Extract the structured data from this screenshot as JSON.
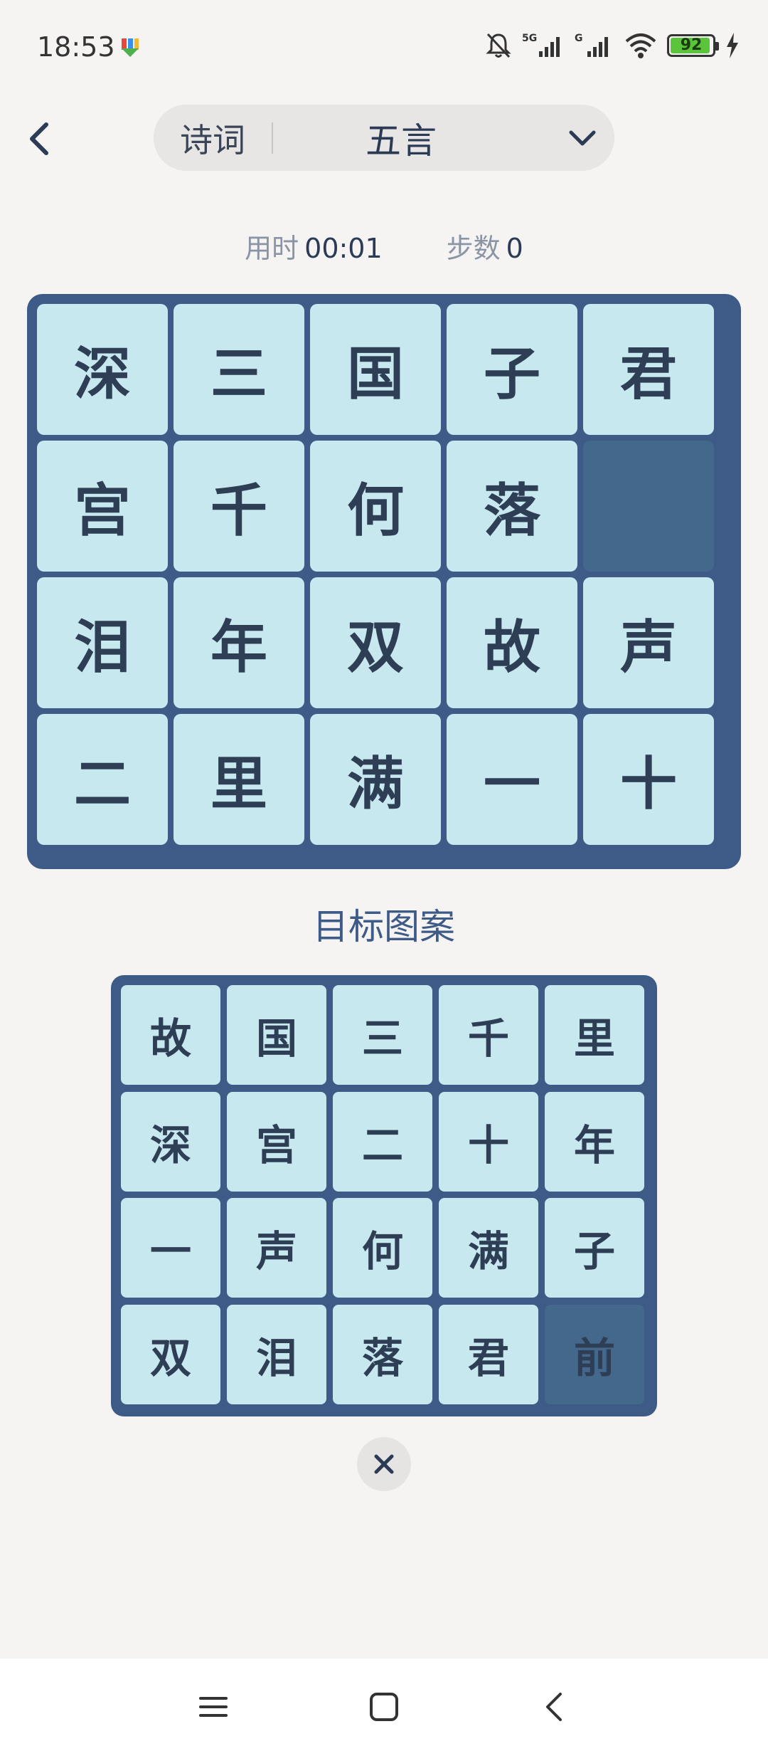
{
  "status_bar": {
    "time": "18:53",
    "battery_level": "92",
    "icons": [
      "download-icon",
      "mute-bell-icon",
      "signal-5g-icon",
      "signal-g-icon",
      "wifi-icon",
      "battery-icon",
      "charging-icon"
    ]
  },
  "header": {
    "category": "诗词",
    "mode": "五言"
  },
  "stats": {
    "time_label": "用时",
    "time_value": "00:01",
    "steps_label": "步数",
    "steps_value": "0"
  },
  "board": {
    "rows": [
      [
        "深",
        "三",
        "国",
        "子",
        "君"
      ],
      [
        "宫",
        "千",
        "何",
        "落",
        ""
      ],
      [
        "泪",
        "年",
        "双",
        "故",
        "声"
      ],
      [
        "二",
        "里",
        "满",
        "一",
        "十"
      ]
    ]
  },
  "target": {
    "title": "目标图案",
    "rows": [
      [
        "故",
        "国",
        "三",
        "千",
        "里"
      ],
      [
        "深",
        "宫",
        "二",
        "十",
        "年"
      ],
      [
        "一",
        "声",
        "何",
        "满",
        "子"
      ],
      [
        "双",
        "泪",
        "落",
        "君",
        "前"
      ]
    ],
    "empty_cell": [
      3,
      4
    ]
  },
  "colors": {
    "board_frame": "#3e5a86",
    "tile": "#c8e8f0",
    "empty_tile": "#44678c",
    "text": "#2e3e55",
    "background": "#f6f4f3"
  }
}
